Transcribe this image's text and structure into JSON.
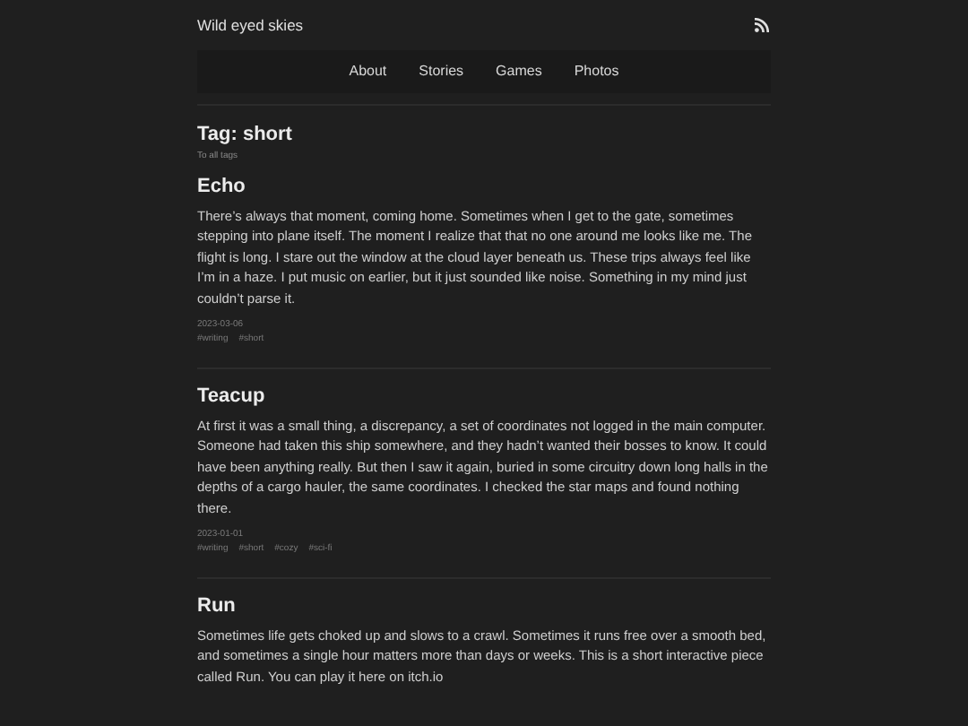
{
  "site_title": "Wild eyed skies",
  "nav": [
    "About",
    "Stories",
    "Games",
    "Photos"
  ],
  "heading": "Tag: short",
  "back_link": "To all tags",
  "posts": [
    {
      "title": "Echo",
      "body": "There’s always that moment, coming home. Sometimes when I get to the gate, sometimes stepping into plane itself. The moment I realize that that no one around me looks like me. The flight is long. I stare out the window at the cloud layer beneath us. These trips always feel like I’m in a haze. I put music on earlier, but it just sounded like noise. Something in my mind just couldn’t parse it.",
      "date": "2023-03-06",
      "tags": [
        "#writing",
        "#short"
      ]
    },
    {
      "title": "Teacup",
      "body": "At first it was a small thing, a discrepancy, a set of coordinates not logged in the main computer. Someone had taken this ship somewhere, and they hadn’t wanted their bosses to know. It could have been anything really. But then I saw it again, buried in some circuitry down long halls in the depths of a cargo hauler, the same coordinates. I checked the star maps and found nothing there.",
      "date": "2023-01-01",
      "tags": [
        "#writing",
        "#short",
        "#cozy",
        "#sci-fi"
      ]
    },
    {
      "title": "Run",
      "body": "Sometimes life gets choked up and slows to a crawl. Sometimes it runs free over a smooth bed, and sometimes a single hour matters more than days or weeks. This is a short interactive piece called Run. You can play it here on itch.io"
    }
  ]
}
